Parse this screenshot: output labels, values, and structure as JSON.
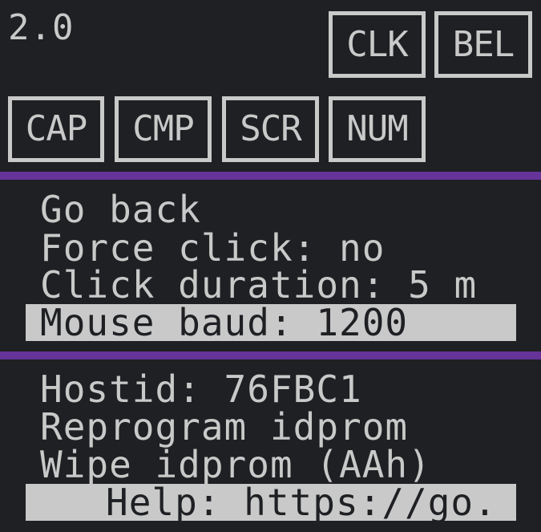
{
  "header": {
    "version": "2.0",
    "status_flags_top": [
      {
        "id": "clk",
        "label": "CLK"
      },
      {
        "id": "bel",
        "label": "BEL"
      }
    ],
    "status_flags_bottom": [
      {
        "id": "cap",
        "label": "CAP"
      },
      {
        "id": "cmp",
        "label": "CMP"
      },
      {
        "id": "scr",
        "label": "SCR"
      },
      {
        "id": "num",
        "label": "NUM"
      }
    ]
  },
  "menu_mouse": {
    "items": [
      {
        "label": "Go back"
      },
      {
        "label": "Force click: no"
      },
      {
        "label": "Click duration: 5 m"
      },
      {
        "label": "Mouse baud: 1200",
        "selected": true
      }
    ]
  },
  "menu_idprom": {
    "items": [
      {
        "label": "Hostid: 76FBC1"
      },
      {
        "label": "Reprogram idprom"
      },
      {
        "label": "Wipe idprom (AAh)"
      },
      {
        "label": "Help: https://go.",
        "selected": true
      }
    ]
  },
  "colors": {
    "background": "#1f2023",
    "foreground": "#c8c9c8",
    "divider": "#663399"
  }
}
